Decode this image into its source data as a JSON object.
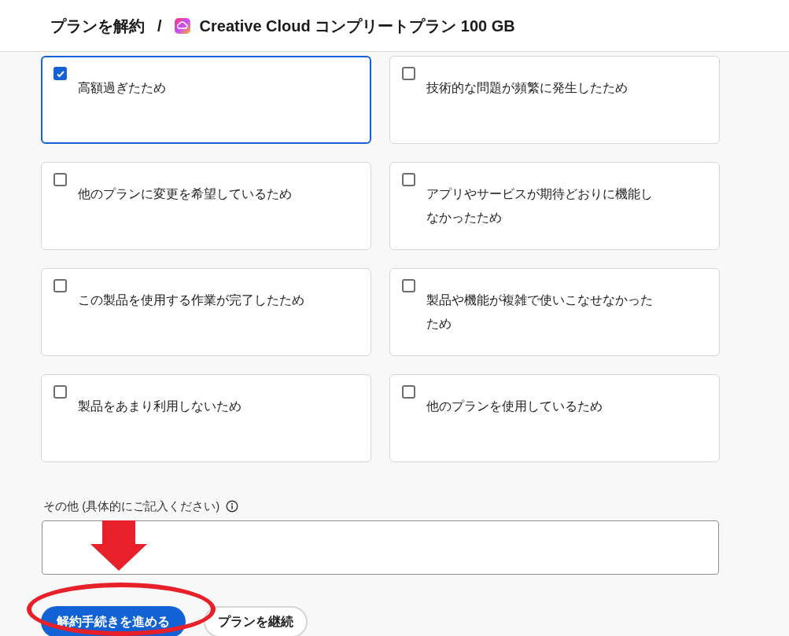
{
  "header": {
    "title": "プランを解約",
    "separator": "/",
    "product": "Creative Cloud コンプリートプラン 100 GB"
  },
  "reasons": [
    {
      "label": "高額過ぎたため",
      "checked": true
    },
    {
      "label": "技術的な問題が頻繁に発生したため",
      "checked": false
    },
    {
      "label": "他のプランに変更を希望しているため",
      "checked": false
    },
    {
      "label": "アプリやサービスが期待どおりに機能しなかったため",
      "checked": false
    },
    {
      "label": "この製品を使用する作業が完了したため",
      "checked": false
    },
    {
      "label": "製品や機能が複雑で使いこなせなかったため",
      "checked": false
    },
    {
      "label": "製品をあまり利用しないため",
      "checked": false
    },
    {
      "label": "他のプランを使用しているため",
      "checked": false
    }
  ],
  "other": {
    "label": "その他 (具体的にご記入ください)"
  },
  "buttons": [
    {
      "label": "解約手続きを進める",
      "kind": "primary"
    },
    {
      "label": "プランを継続",
      "kind": "secondary"
    }
  ]
}
